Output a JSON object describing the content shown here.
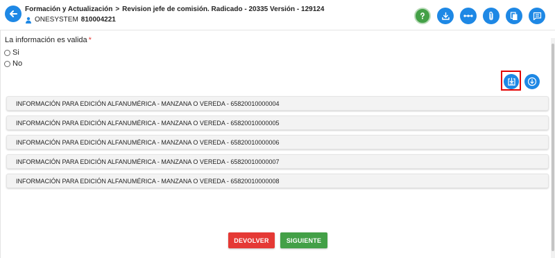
{
  "header": {
    "breadcrumb_root": "Formación y Actualización",
    "breadcrumb_separator": ">",
    "breadcrumb_title": "Revision jefe de comisión. Radicado - 20335 Versión - 129124",
    "user_name": "ONESYSTEM",
    "user_id": "810004221"
  },
  "toolbar": {
    "icons": [
      "help-icon",
      "download-icon",
      "flow-icon",
      "attachment-icon",
      "documents-icon",
      "notes-icon"
    ]
  },
  "form": {
    "question": "La información es valida",
    "required_mark": "*",
    "options": [
      "Si",
      "No"
    ]
  },
  "panels": [
    "INFORMACIÓN PARA EDICIÓN ALFANUMÉRICA - MANZANA O VEREDA - 65820010000004",
    "INFORMACIÓN PARA EDICIÓN ALFANUMÉRICA - MANZANA O VEREDA - 65820010000005",
    "INFORMACIÓN PARA EDICIÓN ALFANUMÉRICA - MANZANA O VEREDA - 65820010000006",
    "INFORMACIÓN PARA EDICIÓN ALFANUMÉRICA - MANZANA O VEREDA - 65820010000007",
    "INFORMACIÓN PARA EDICIÓN ALFANUMÉRICA - MANZANA O VEREDA - 65820010000008"
  ],
  "footer": {
    "return_label": "DEVOLVER",
    "next_label": "SIGUIENTE"
  },
  "colors": {
    "primary": "#1e88e5",
    "success": "#43a047",
    "danger": "#e53935",
    "highlight": "#e30000"
  }
}
